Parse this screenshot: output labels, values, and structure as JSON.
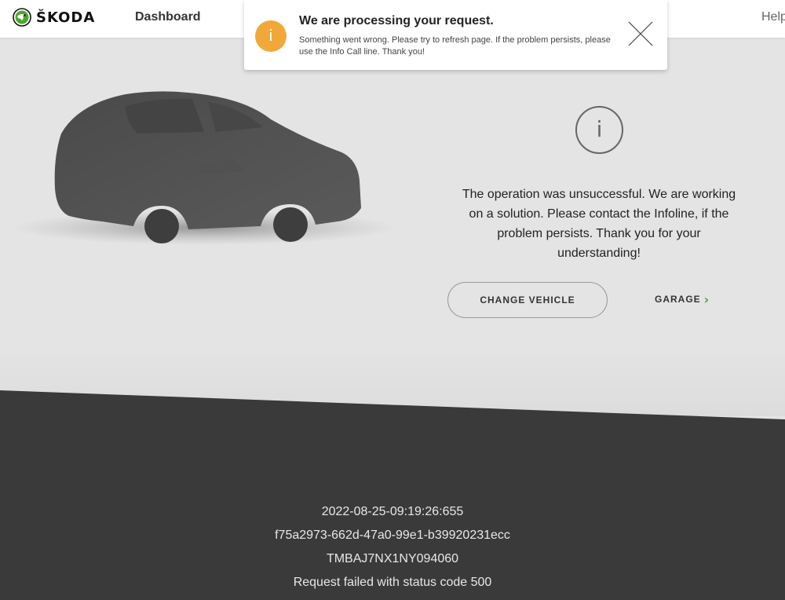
{
  "header": {
    "brand": "ŠKODA",
    "nav_dashboard": "Dashboard",
    "nav_help": "Help"
  },
  "toast": {
    "icon": "info-icon",
    "icon_glyph": "i",
    "title": "We are processing your request.",
    "message": "Something went wrong. Please try to refresh page. If the problem persists, please use the Info Call line. Thank you!",
    "accent_color": "#f0a83a"
  },
  "main": {
    "info_glyph": "i",
    "message": "The operation was unsuccessful. We are working on a solution. Please contact the Infoline, if the problem persists. Thank you for your understanding!",
    "change_vehicle_label": "CHANGE VEHICLE",
    "garage_label": "GARAGE",
    "garage_chevron": "›",
    "accent_color": "#4ba82e"
  },
  "footer": {
    "timestamp": "2022-08-25-09:19:26:655",
    "request_id": "f75a2973-662d-47a0-99e1-b39920231ecc",
    "vin": "TMBAJ7NX1NY094060",
    "error": "Request failed with status code 500"
  }
}
